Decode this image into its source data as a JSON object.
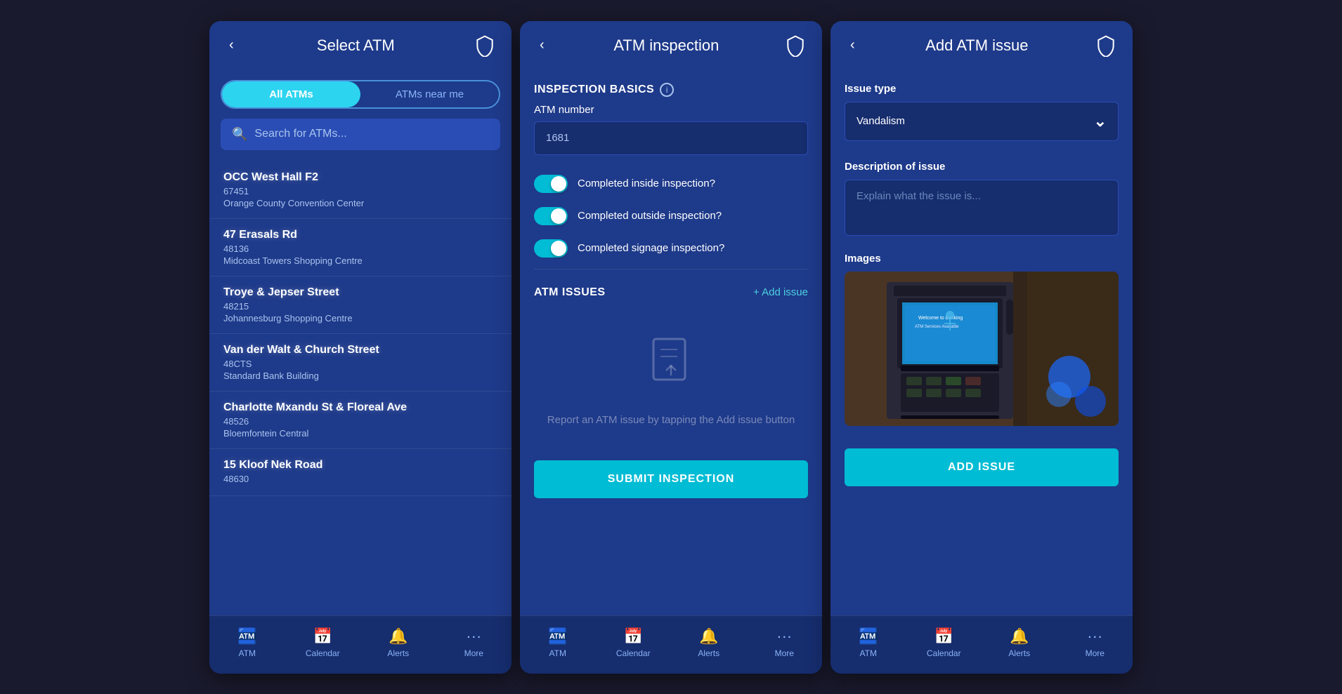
{
  "screen1": {
    "title": "Select ATM",
    "back_label": "‹",
    "tabs": [
      {
        "label": "All ATMs",
        "active": true
      },
      {
        "label": "ATMs near me",
        "active": false
      }
    ],
    "search_placeholder": "Search for ATMs...",
    "atm_items": [
      {
        "name": "OCC West Hall F2",
        "code": "67451",
        "location": "Orange County Convention Center"
      },
      {
        "name": "47 Erasals Rd",
        "code": "48136",
        "location": "Midcoast Towers Shopping Centre"
      },
      {
        "name": "Troye & Jepser Street",
        "code": "48215",
        "location": "Johannesburg Shopping Centre"
      },
      {
        "name": "Van der Walt & Church Street",
        "code": "48CTS",
        "location": "Standard Bank Building"
      },
      {
        "name": "Charlotte Mxandu St & Floreal Ave",
        "code": "48526",
        "location": "Bloemfontein Central"
      },
      {
        "name": "15 Kloof Nek Road",
        "code": "48630",
        "location": ""
      }
    ],
    "nav": [
      {
        "label": "ATM",
        "icon": "atm"
      },
      {
        "label": "Calendar",
        "icon": "calendar"
      },
      {
        "label": "Alerts",
        "icon": "bell"
      },
      {
        "label": "More",
        "icon": "more"
      }
    ]
  },
  "screen2": {
    "title": "ATM inspection",
    "back_label": "‹",
    "section_inspection": "INSPECTION BASICS",
    "atm_number_label": "ATM number",
    "atm_number_value": "1681",
    "toggles": [
      {
        "label": "Completed inside inspection?",
        "on": true
      },
      {
        "label": "Completed outside inspection?",
        "on": true
      },
      {
        "label": "Completed signage inspection?",
        "on": true
      }
    ],
    "section_issues": "ATM ISSUES",
    "add_issue_label": "+ Add issue",
    "empty_state_text": "Report an ATM issue by\ntapping the Add issue button",
    "submit_btn": "SUBMIT INSPECTION",
    "nav": [
      {
        "label": "ATM",
        "icon": "atm"
      },
      {
        "label": "Calendar",
        "icon": "calendar"
      },
      {
        "label": "Alerts",
        "icon": "bell"
      },
      {
        "label": "More",
        "icon": "more"
      }
    ]
  },
  "screen3": {
    "title": "Add ATM issue",
    "back_label": "‹",
    "issue_type_label": "Issue type",
    "issue_type_value": "Vandalism",
    "description_label": "Description of issue",
    "description_placeholder": "Explain what the issue is...",
    "images_label": "Images",
    "add_issue_btn": "ADD ISSUE",
    "nav": [
      {
        "label": "ATM",
        "icon": "atm"
      },
      {
        "label": "Calendar",
        "icon": "calendar"
      },
      {
        "label": "Alerts",
        "icon": "bell"
      },
      {
        "label": "More",
        "icon": "more"
      }
    ]
  },
  "colors": {
    "primary_bg": "#1e3a8a",
    "dark_bg": "#162d6e",
    "accent_cyan": "#00bcd4",
    "text_primary": "#ffffff",
    "text_secondary": "#aac4ee"
  }
}
